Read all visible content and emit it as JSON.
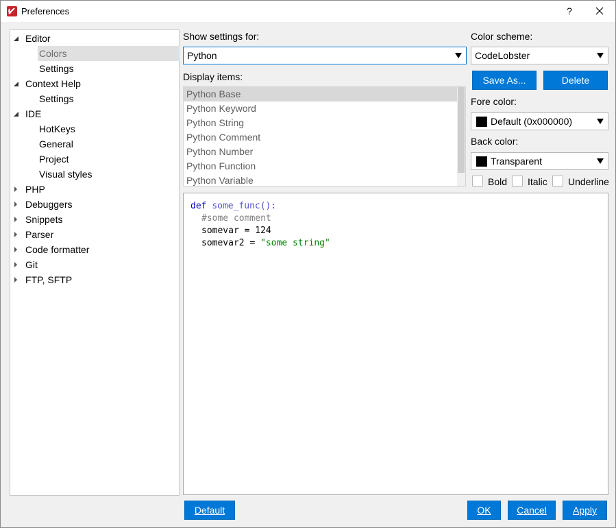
{
  "window": {
    "title": "Preferences",
    "help_glyph": "?",
    "close_glyph": "✕"
  },
  "tree": [
    {
      "label": "Editor",
      "expanded": true
    },
    {
      "label": "Colors",
      "selected": true
    },
    {
      "label": "Settings"
    },
    {
      "label": "Context Help",
      "expanded": true
    },
    {
      "label": "Settings"
    },
    {
      "label": "IDE",
      "expanded": true
    },
    {
      "label": "HotKeys"
    },
    {
      "label": "General"
    },
    {
      "label": "Project"
    },
    {
      "label": "Visual styles"
    },
    {
      "label": "PHP",
      "expanded": false
    },
    {
      "label": "Debuggers",
      "expanded": false
    },
    {
      "label": "Snippets",
      "expanded": false
    },
    {
      "label": "Parser",
      "expanded": false
    },
    {
      "label": "Code formatter",
      "expanded": false
    },
    {
      "label": "Git",
      "expanded": false
    },
    {
      "label": "FTP, SFTP",
      "expanded": false
    }
  ],
  "show_settings": {
    "label": "Show settings for:",
    "value": "Python"
  },
  "display_items": {
    "label": "Display items:",
    "items": [
      "Python Base",
      "Python Keyword",
      "Python String",
      "Python Comment",
      "Python Number",
      "Python Function",
      "Python Variable"
    ],
    "selected_index": 0
  },
  "color_scheme": {
    "label": "Color scheme:",
    "value": "CodeLobster",
    "save_as": "Save As...",
    "delete": "Delete"
  },
  "fore_color": {
    "label": "Fore color:",
    "value": "Default (0x000000)",
    "swatch": "#000000"
  },
  "back_color": {
    "label": "Back color:",
    "value": "Transparent",
    "swatch": "#000000"
  },
  "style_options": {
    "bold": "Bold",
    "italic": "Italic",
    "underline": "Underline"
  },
  "preview": {
    "line1_kw": "def",
    "line1_fn": "some_func():",
    "line2": "#some comment",
    "line3": "somevar = 124",
    "line4_prefix": "somevar2 = ",
    "line4_str": "\"some string\""
  },
  "buttons": {
    "default": "Default",
    "ok": "OK",
    "cancel": "Cancel",
    "apply": "Apply"
  },
  "colors": {
    "accent": "#0078d7",
    "keyword": "#0000c0",
    "comment": "#808080",
    "string": "#008000"
  }
}
